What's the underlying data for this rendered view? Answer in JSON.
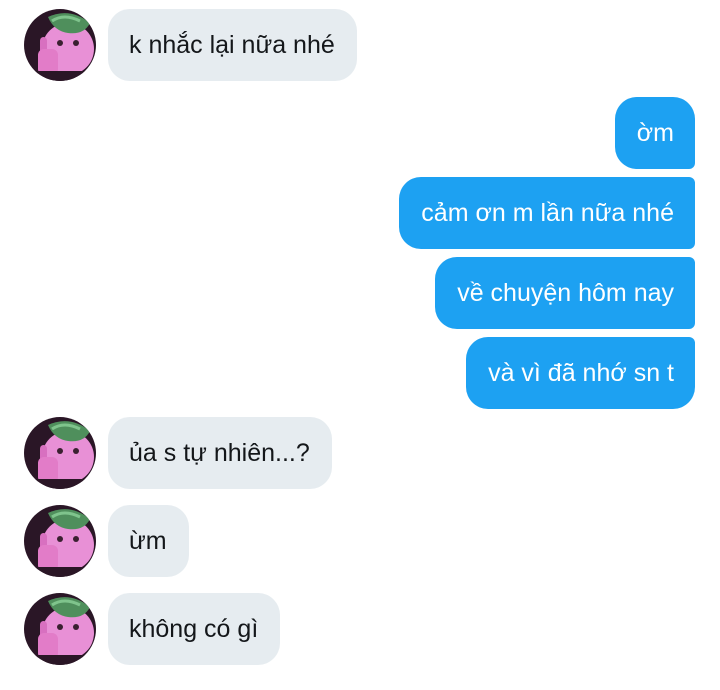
{
  "messages": [
    {
      "side": "received",
      "text": "k nhắc lại nữa nhé"
    },
    {
      "side": "sent",
      "text": "ờm"
    },
    {
      "side": "sent",
      "text": "cảm ơn m lần nữa nhé"
    },
    {
      "side": "sent",
      "text": "về chuyện hôm nay"
    },
    {
      "side": "sent",
      "text": "và vì đã nhớ sn t"
    },
    {
      "side": "received",
      "text": "ủa s tự nhiên...?"
    },
    {
      "side": "received",
      "text": "ừm"
    },
    {
      "side": "received",
      "text": "không có gì"
    }
  ],
  "colors": {
    "sent_bubble": "#1da1f2",
    "sent_text": "#ffffff",
    "received_bubble": "#e6ecf0",
    "received_text": "#14171a"
  },
  "avatar_icon": "user-avatar-photo"
}
